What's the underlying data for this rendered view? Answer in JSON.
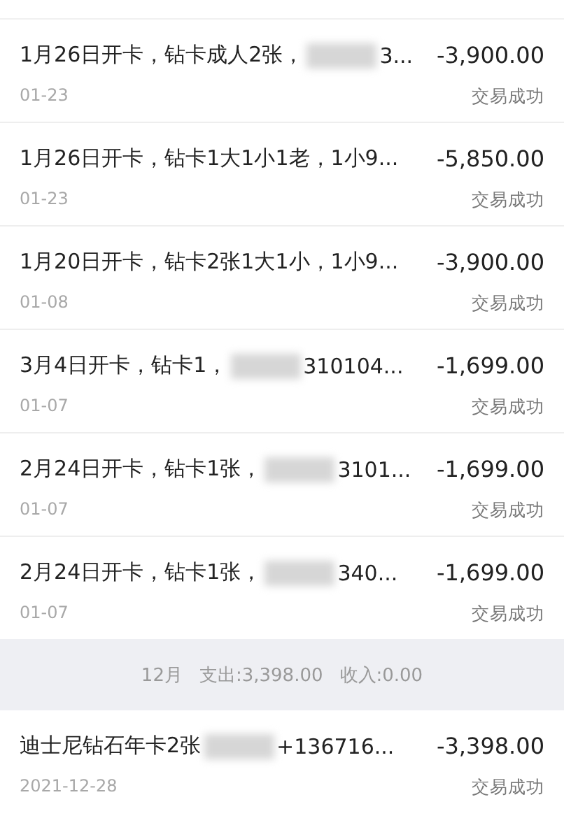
{
  "transactions": [
    {
      "title": "1月26日开卡，钻卡成人2张，",
      "redacted": true,
      "title_after": "3...",
      "amount": "-3,900.00",
      "date": "01-23",
      "status": "交易成功"
    },
    {
      "title": "1月26日开卡，钻卡1大1小1老，1小9...",
      "redacted": false,
      "amount": "-5,850.00",
      "date": "01-23",
      "status": "交易成功"
    },
    {
      "title": "1月20日开卡，钻卡2张1大1小，1小9...",
      "redacted": false,
      "amount": "-3,900.00",
      "date": "01-08",
      "status": "交易成功"
    },
    {
      "title": "3月4日开卡，钻卡1，",
      "redacted": true,
      "title_after": "310104...",
      "amount": "-1,699.00",
      "date": "01-07",
      "status": "交易成功"
    },
    {
      "title": "2月24日开卡，钻卡1张，",
      "redacted": true,
      "title_after": "3101...",
      "amount": "-1,699.00",
      "date": "01-07",
      "status": "交易成功"
    },
    {
      "title": "2月24日开卡，钻卡1张，",
      "redacted": true,
      "title_after": "340...",
      "amount": "-1,699.00",
      "date": "01-07",
      "status": "交易成功"
    }
  ],
  "month_summary": {
    "month": "12月",
    "expense": "支出:3,398.00",
    "income": "收入:0.00"
  },
  "later_transactions": [
    {
      "title": "迪士尼钻石年卡2张",
      "redacted": true,
      "title_after": "+136716...",
      "amount": "-3,398.00",
      "date": "2021-12-28",
      "status": "交易成功"
    }
  ]
}
